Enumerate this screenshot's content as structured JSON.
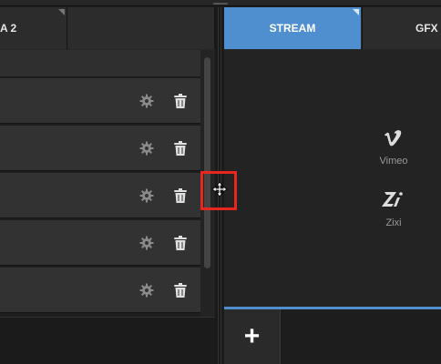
{
  "left_panel": {
    "tabs": [
      {
        "label": "A 2"
      },
      {
        "label": ""
      }
    ],
    "rows": [
      {
        "gear_icon": "gear-icon",
        "delete_icon": "trash-icon"
      },
      {
        "gear_icon": "gear-icon",
        "delete_icon": "trash-icon"
      },
      {
        "gear_icon": "gear-icon",
        "delete_icon": "trash-icon"
      },
      {
        "gear_icon": "gear-icon",
        "delete_icon": "trash-icon"
      },
      {
        "gear_icon": "gear-icon",
        "delete_icon": "trash-icon"
      }
    ]
  },
  "right_panel": {
    "tabs": [
      {
        "label": "STREAM",
        "active": true
      },
      {
        "label": "GFX",
        "active": false
      }
    ],
    "providers": [
      {
        "name": "Vimeo",
        "icon": "vimeo-icon"
      },
      {
        "name": "Zixi",
        "icon": "zixi-icon"
      }
    ],
    "add_button": {
      "label": "+"
    }
  },
  "colors": {
    "accent": "#4f8fd0",
    "highlight": "#e8261b",
    "background": "#1f1f1f"
  }
}
